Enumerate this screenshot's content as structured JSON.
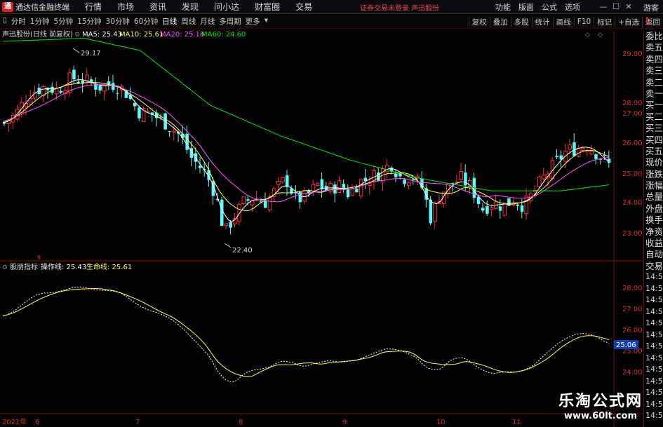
{
  "titlebar": {
    "app_name": "通达信金融终端",
    "menu": [
      "行情",
      "市场",
      "资讯",
      "发现",
      "问小达",
      "财富圈",
      "交易"
    ],
    "warning": "证券交易未登录  声迅股份",
    "right_menu": [
      "功能",
      "版面",
      "公式",
      "选项"
    ],
    "guest": "游客"
  },
  "toolbar": {
    "periods": [
      "分时",
      "1分钟",
      "5分钟",
      "15分钟",
      "30分钟",
      "60分钟",
      "日线",
      "周线",
      "月线",
      "多周期",
      "更多"
    ],
    "active_period": "日线",
    "right_tools": [
      "复权",
      "叠加",
      "多股",
      "统计",
      "画线",
      "F10",
      "标记",
      "+自选",
      "返回"
    ]
  },
  "main_chart": {
    "legend_title": "声迅股份(日线 前复权)",
    "ma5": "MA5: 25.43",
    "ma10": "MA10: 25.61",
    "ma20": "MA20: 25.18",
    "ma60": "MA60: 24.60",
    "high_label": "29.17",
    "low_label": "22.40",
    "y_ticks": [
      "29.00",
      "28.00",
      "27.00",
      "26.00",
      "25.00",
      "24.00",
      "23.00"
    ],
    "colors": {
      "up": "#ff3232",
      "down": "#54ffff",
      "ma5": "#ffffff",
      "ma10": "#ffff54",
      "ma20": "#ff54ff",
      "ma60": "#00e600"
    }
  },
  "sub_chart": {
    "title": "股朋指标",
    "op_line": "操作线: 25.43",
    "life_line": "生命线: 25.61",
    "y_ticks": [
      "28.00",
      "27.00",
      "26.00",
      "25.00",
      "24.00"
    ],
    "current_value": "25.06"
  },
  "x_axis": {
    "year": "2021年",
    "months": [
      "6",
      "7",
      "8",
      "9",
      "10",
      "11"
    ]
  },
  "side_panel": {
    "corner": "L",
    "rows": [
      "委比",
      "卖五",
      "卖四",
      "卖三",
      "卖二",
      "卖一",
      "买一",
      "买二",
      "买三",
      "买四",
      "买五",
      "现价",
      "涨跌",
      "涨幅",
      "总量",
      "外盘",
      "换手",
      "净资",
      "收益",
      "自动",
      "交易"
    ],
    "times": [
      "14:56",
      "14:56",
      "14:56",
      "14:56",
      "14:56",
      "14:56",
      "14:56",
      "14:56",
      "14:56",
      "14:56",
      "14:56",
      "14:56",
      "14:56"
    ]
  },
  "watermark": {
    "line1": "乐淘公式网",
    "line2": "www.60lt.com"
  }
}
